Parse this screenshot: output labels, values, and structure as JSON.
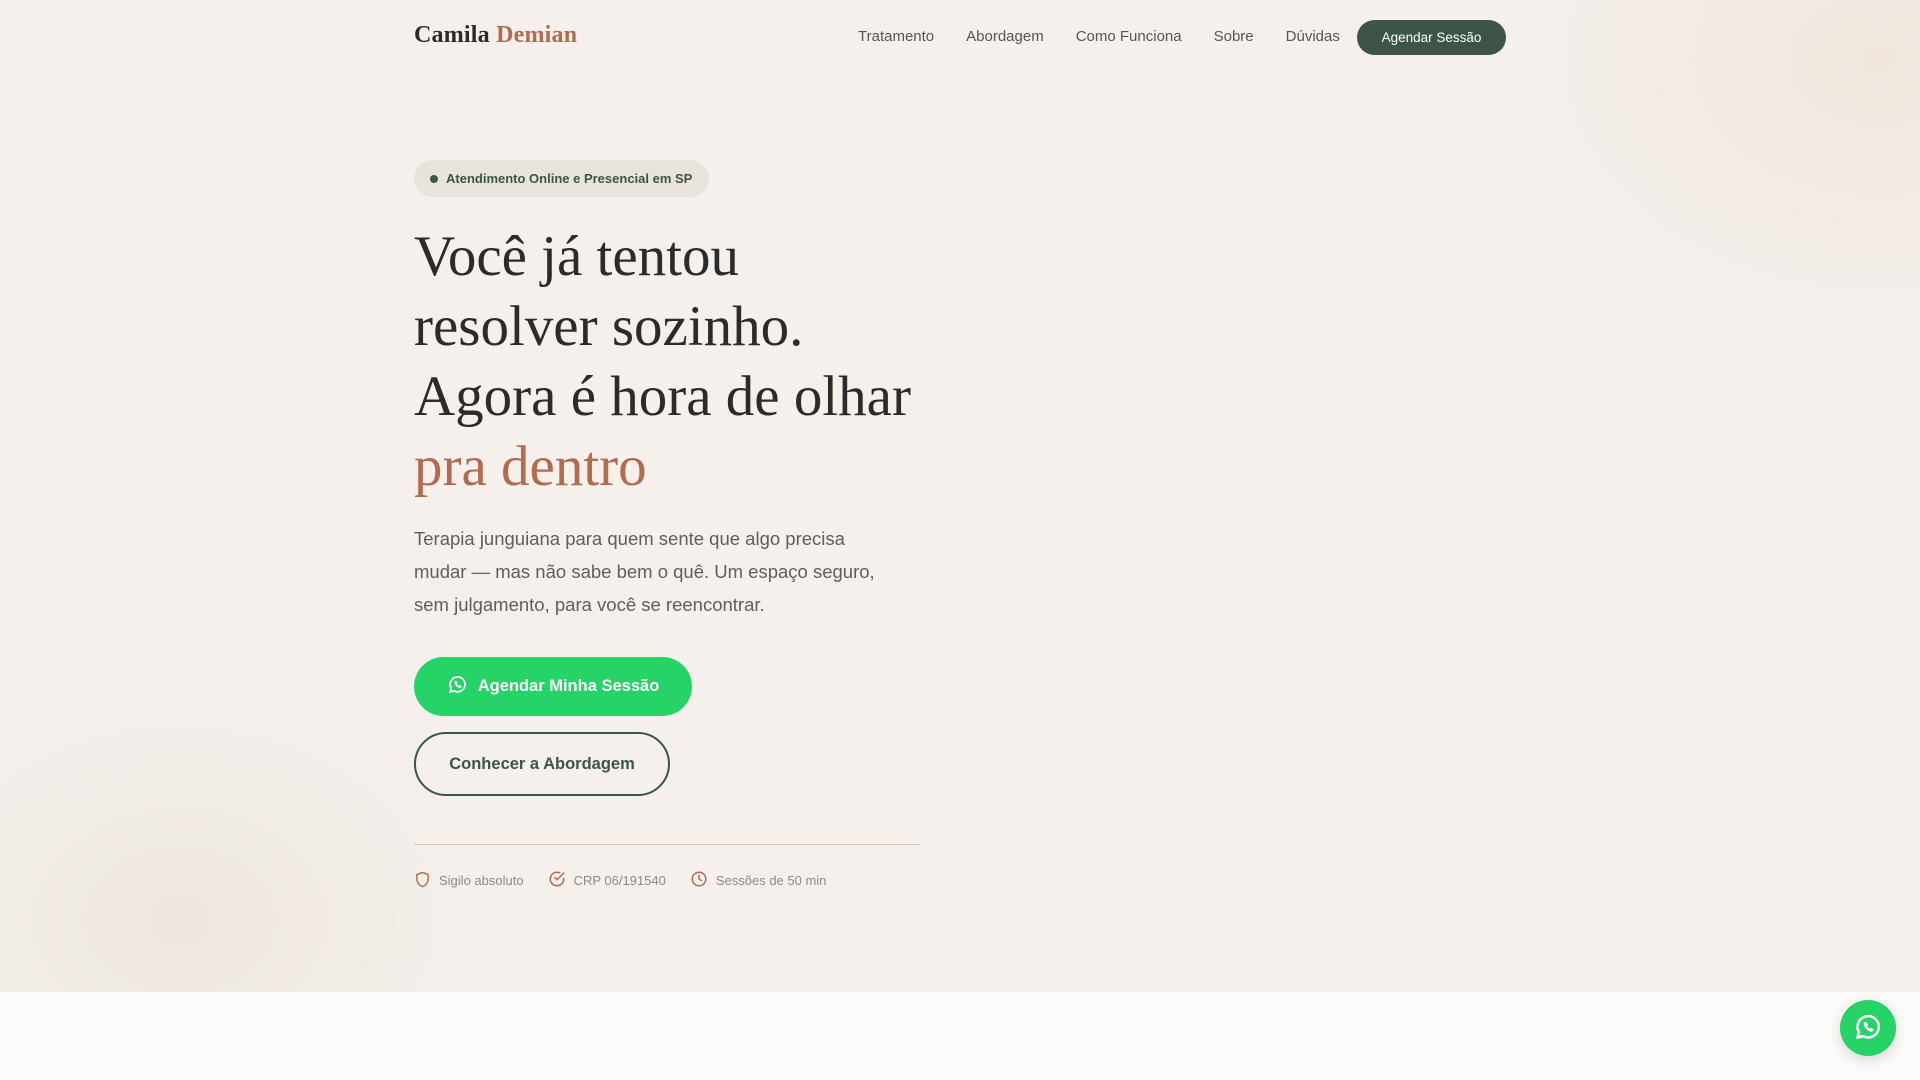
{
  "brand": {
    "first": "Camila",
    "last": "Demian"
  },
  "nav": {
    "items": [
      "Tratamento",
      "Abordagem",
      "Como Funciona",
      "Sobre",
      "Dúvidas"
    ],
    "cta": "Agendar Sessão"
  },
  "hero": {
    "badge": "Atendimento Online e Presencial em SP",
    "headline_lines": [
      "Você já tentou",
      "resolver sozinho.",
      "Agora é hora de olhar"
    ],
    "headline_accent": "pra dentro",
    "subtitle": "Terapia junguiana para quem sente que algo precisa mudar — mas não sabe bem o quê. Um espaço seguro, sem julgamento, para você se reencontrar.",
    "primary_cta": "Agendar Minha Sessão",
    "secondary_cta": "Conhecer a Abordagem",
    "trust": [
      {
        "icon": "shield-icon",
        "label": "Sigilo absoluto"
      },
      {
        "icon": "check-circle-icon",
        "label": "CRP 06/191540"
      },
      {
        "icon": "clock-icon",
        "label": "Sessões de 50 min"
      }
    ]
  },
  "colors": {
    "background": "#f5f0ec",
    "accent": "#b46a4d",
    "primary_dark": "#3c5546",
    "whatsapp": "#25d366"
  }
}
